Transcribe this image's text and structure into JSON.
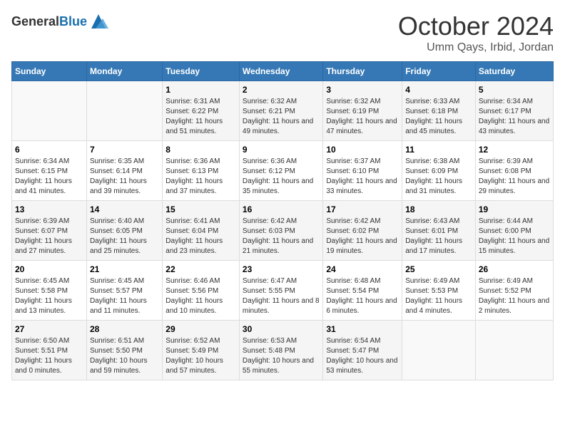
{
  "logo": {
    "general": "General",
    "blue": "Blue"
  },
  "title": {
    "month": "October 2024",
    "location": "Umm Qays, Irbid, Jordan"
  },
  "weekdays": [
    "Sunday",
    "Monday",
    "Tuesday",
    "Wednesday",
    "Thursday",
    "Friday",
    "Saturday"
  ],
  "weeks": [
    [
      {
        "day": "",
        "sunrise": "",
        "sunset": "",
        "daylight": ""
      },
      {
        "day": "",
        "sunrise": "",
        "sunset": "",
        "daylight": ""
      },
      {
        "day": "1",
        "sunrise": "Sunrise: 6:31 AM",
        "sunset": "Sunset: 6:22 PM",
        "daylight": "Daylight: 11 hours and 51 minutes."
      },
      {
        "day": "2",
        "sunrise": "Sunrise: 6:32 AM",
        "sunset": "Sunset: 6:21 PM",
        "daylight": "Daylight: 11 hours and 49 minutes."
      },
      {
        "day": "3",
        "sunrise": "Sunrise: 6:32 AM",
        "sunset": "Sunset: 6:19 PM",
        "daylight": "Daylight: 11 hours and 47 minutes."
      },
      {
        "day": "4",
        "sunrise": "Sunrise: 6:33 AM",
        "sunset": "Sunset: 6:18 PM",
        "daylight": "Daylight: 11 hours and 45 minutes."
      },
      {
        "day": "5",
        "sunrise": "Sunrise: 6:34 AM",
        "sunset": "Sunset: 6:17 PM",
        "daylight": "Daylight: 11 hours and 43 minutes."
      }
    ],
    [
      {
        "day": "6",
        "sunrise": "Sunrise: 6:34 AM",
        "sunset": "Sunset: 6:15 PM",
        "daylight": "Daylight: 11 hours and 41 minutes."
      },
      {
        "day": "7",
        "sunrise": "Sunrise: 6:35 AM",
        "sunset": "Sunset: 6:14 PM",
        "daylight": "Daylight: 11 hours and 39 minutes."
      },
      {
        "day": "8",
        "sunrise": "Sunrise: 6:36 AM",
        "sunset": "Sunset: 6:13 PM",
        "daylight": "Daylight: 11 hours and 37 minutes."
      },
      {
        "day": "9",
        "sunrise": "Sunrise: 6:36 AM",
        "sunset": "Sunset: 6:12 PM",
        "daylight": "Daylight: 11 hours and 35 minutes."
      },
      {
        "day": "10",
        "sunrise": "Sunrise: 6:37 AM",
        "sunset": "Sunset: 6:10 PM",
        "daylight": "Daylight: 11 hours and 33 minutes."
      },
      {
        "day": "11",
        "sunrise": "Sunrise: 6:38 AM",
        "sunset": "Sunset: 6:09 PM",
        "daylight": "Daylight: 11 hours and 31 minutes."
      },
      {
        "day": "12",
        "sunrise": "Sunrise: 6:39 AM",
        "sunset": "Sunset: 6:08 PM",
        "daylight": "Daylight: 11 hours and 29 minutes."
      }
    ],
    [
      {
        "day": "13",
        "sunrise": "Sunrise: 6:39 AM",
        "sunset": "Sunset: 6:07 PM",
        "daylight": "Daylight: 11 hours and 27 minutes."
      },
      {
        "day": "14",
        "sunrise": "Sunrise: 6:40 AM",
        "sunset": "Sunset: 6:05 PM",
        "daylight": "Daylight: 11 hours and 25 minutes."
      },
      {
        "day": "15",
        "sunrise": "Sunrise: 6:41 AM",
        "sunset": "Sunset: 6:04 PM",
        "daylight": "Daylight: 11 hours and 23 minutes."
      },
      {
        "day": "16",
        "sunrise": "Sunrise: 6:42 AM",
        "sunset": "Sunset: 6:03 PM",
        "daylight": "Daylight: 11 hours and 21 minutes."
      },
      {
        "day": "17",
        "sunrise": "Sunrise: 6:42 AM",
        "sunset": "Sunset: 6:02 PM",
        "daylight": "Daylight: 11 hours and 19 minutes."
      },
      {
        "day": "18",
        "sunrise": "Sunrise: 6:43 AM",
        "sunset": "Sunset: 6:01 PM",
        "daylight": "Daylight: 11 hours and 17 minutes."
      },
      {
        "day": "19",
        "sunrise": "Sunrise: 6:44 AM",
        "sunset": "Sunset: 6:00 PM",
        "daylight": "Daylight: 11 hours and 15 minutes."
      }
    ],
    [
      {
        "day": "20",
        "sunrise": "Sunrise: 6:45 AM",
        "sunset": "Sunset: 5:58 PM",
        "daylight": "Daylight: 11 hours and 13 minutes."
      },
      {
        "day": "21",
        "sunrise": "Sunrise: 6:45 AM",
        "sunset": "Sunset: 5:57 PM",
        "daylight": "Daylight: 11 hours and 11 minutes."
      },
      {
        "day": "22",
        "sunrise": "Sunrise: 6:46 AM",
        "sunset": "Sunset: 5:56 PM",
        "daylight": "Daylight: 11 hours and 10 minutes."
      },
      {
        "day": "23",
        "sunrise": "Sunrise: 6:47 AM",
        "sunset": "Sunset: 5:55 PM",
        "daylight": "Daylight: 11 hours and 8 minutes."
      },
      {
        "day": "24",
        "sunrise": "Sunrise: 6:48 AM",
        "sunset": "Sunset: 5:54 PM",
        "daylight": "Daylight: 11 hours and 6 minutes."
      },
      {
        "day": "25",
        "sunrise": "Sunrise: 6:49 AM",
        "sunset": "Sunset: 5:53 PM",
        "daylight": "Daylight: 11 hours and 4 minutes."
      },
      {
        "day": "26",
        "sunrise": "Sunrise: 6:49 AM",
        "sunset": "Sunset: 5:52 PM",
        "daylight": "Daylight: 11 hours and 2 minutes."
      }
    ],
    [
      {
        "day": "27",
        "sunrise": "Sunrise: 6:50 AM",
        "sunset": "Sunset: 5:51 PM",
        "daylight": "Daylight: 11 hours and 0 minutes."
      },
      {
        "day": "28",
        "sunrise": "Sunrise: 6:51 AM",
        "sunset": "Sunset: 5:50 PM",
        "daylight": "Daylight: 10 hours and 59 minutes."
      },
      {
        "day": "29",
        "sunrise": "Sunrise: 6:52 AM",
        "sunset": "Sunset: 5:49 PM",
        "daylight": "Daylight: 10 hours and 57 minutes."
      },
      {
        "day": "30",
        "sunrise": "Sunrise: 6:53 AM",
        "sunset": "Sunset: 5:48 PM",
        "daylight": "Daylight: 10 hours and 55 minutes."
      },
      {
        "day": "31",
        "sunrise": "Sunrise: 6:54 AM",
        "sunset": "Sunset: 5:47 PM",
        "daylight": "Daylight: 10 hours and 53 minutes."
      },
      {
        "day": "",
        "sunrise": "",
        "sunset": "",
        "daylight": ""
      },
      {
        "day": "",
        "sunrise": "",
        "sunset": "",
        "daylight": ""
      }
    ]
  ]
}
